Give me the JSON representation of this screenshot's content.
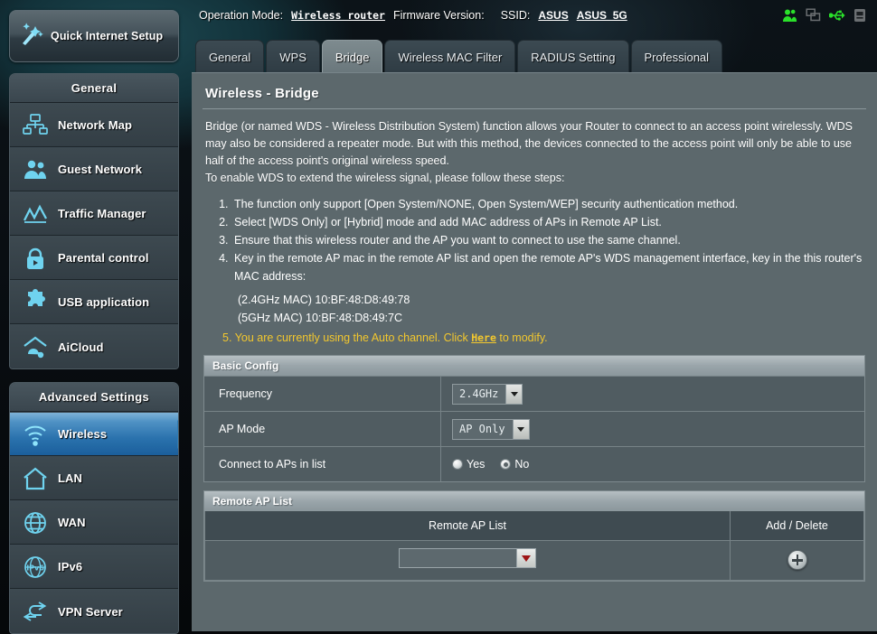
{
  "topbar": {
    "operation_mode_label": "Operation Mode:",
    "operation_mode_value": "Wireless router",
    "firmware_label": "Firmware Version:",
    "firmware_value": "",
    "ssid_label": "SSID:",
    "ssid_value_1": "ASUS",
    "ssid_value_2": "ASUS_5G",
    "icons": [
      "clients-icon",
      "monitors-icon",
      "usb-icon",
      "printer-icon"
    ]
  },
  "sidebar": {
    "quick_setup": {
      "label": "Quick Internet Setup",
      "icon": "magic-wand-icon"
    },
    "groups": [
      {
        "title": "General",
        "items": [
          {
            "label": "Network Map",
            "icon": "network-map-icon",
            "active": false
          },
          {
            "label": "Guest Network",
            "icon": "guest-network-icon",
            "active": false
          },
          {
            "label": "Traffic Manager",
            "icon": "traffic-manager-icon",
            "active": false
          },
          {
            "label": "Parental control",
            "icon": "lock-icon",
            "active": false
          },
          {
            "label": "USB application",
            "icon": "puzzle-icon",
            "active": false
          },
          {
            "label": "AiCloud",
            "icon": "aicloud-icon",
            "active": false
          }
        ]
      },
      {
        "title": "Advanced Settings",
        "items": [
          {
            "label": "Wireless",
            "icon": "wifi-icon",
            "active": true
          },
          {
            "label": "LAN",
            "icon": "home-icon",
            "active": false
          },
          {
            "label": "WAN",
            "icon": "globe-icon",
            "active": false
          },
          {
            "label": "IPv6",
            "icon": "ipv6-globe-icon",
            "active": false
          },
          {
            "label": "VPN Server",
            "icon": "vpn-icon",
            "active": false
          }
        ]
      }
    ]
  },
  "tabs": [
    {
      "label": "General",
      "active": false
    },
    {
      "label": "WPS",
      "active": false
    },
    {
      "label": "Bridge",
      "active": true
    },
    {
      "label": "Wireless MAC Filter",
      "active": false
    },
    {
      "label": "RADIUS Setting",
      "active": false
    },
    {
      "label": "Professional",
      "active": false
    }
  ],
  "page": {
    "title": "Wireless - Bridge",
    "paragraph_1": "Bridge (or named WDS - Wireless Distribution System) function allows your Router to connect to an access point wirelessly. WDS may also be considered a repeater mode. But with this method, the devices connected to the access point will only be able to use half of the access point's original wireless speed.",
    "paragraph_2": "To enable WDS to extend the wireless signal, please follow these steps:",
    "steps": [
      "The function only support [Open System/NONE, Open System/WEP] security authentication method.",
      "Select [WDS Only] or [Hybrid] mode and add MAC address of APs in Remote AP List.",
      "Ensure that this wireless router and the AP you want to connect to use the same channel.",
      "Key in the remote AP mac in the remote AP list and open the remote AP's WDS management interface, key in the this router's MAC address:"
    ],
    "mac_24": "(2.4GHz MAC) 10:BF:48:D8:49:78",
    "mac_5": "(5GHz MAC) 10:BF:48:D8:49:7C",
    "note_number": "5.",
    "note_pre": "You are currently using the Auto channel. Click",
    "note_link": "Here",
    "note_post": "to modify.",
    "note_color": "#f2c72e"
  },
  "basic_config": {
    "section_title": "Basic Config",
    "frequency_label": "Frequency",
    "frequency_value": "2.4GHz",
    "ap_mode_label": "AP Mode",
    "ap_mode_value": "AP Only",
    "connect_label": "Connect to APs in list",
    "radio_yes": "Yes",
    "radio_no": "No",
    "radio_selected": "No"
  },
  "remote_ap": {
    "section_title": "Remote AP List",
    "col_list": "Remote AP List",
    "col_add": "Add / Delete",
    "mac_value": "",
    "add_icon": "plus-circle-icon"
  }
}
